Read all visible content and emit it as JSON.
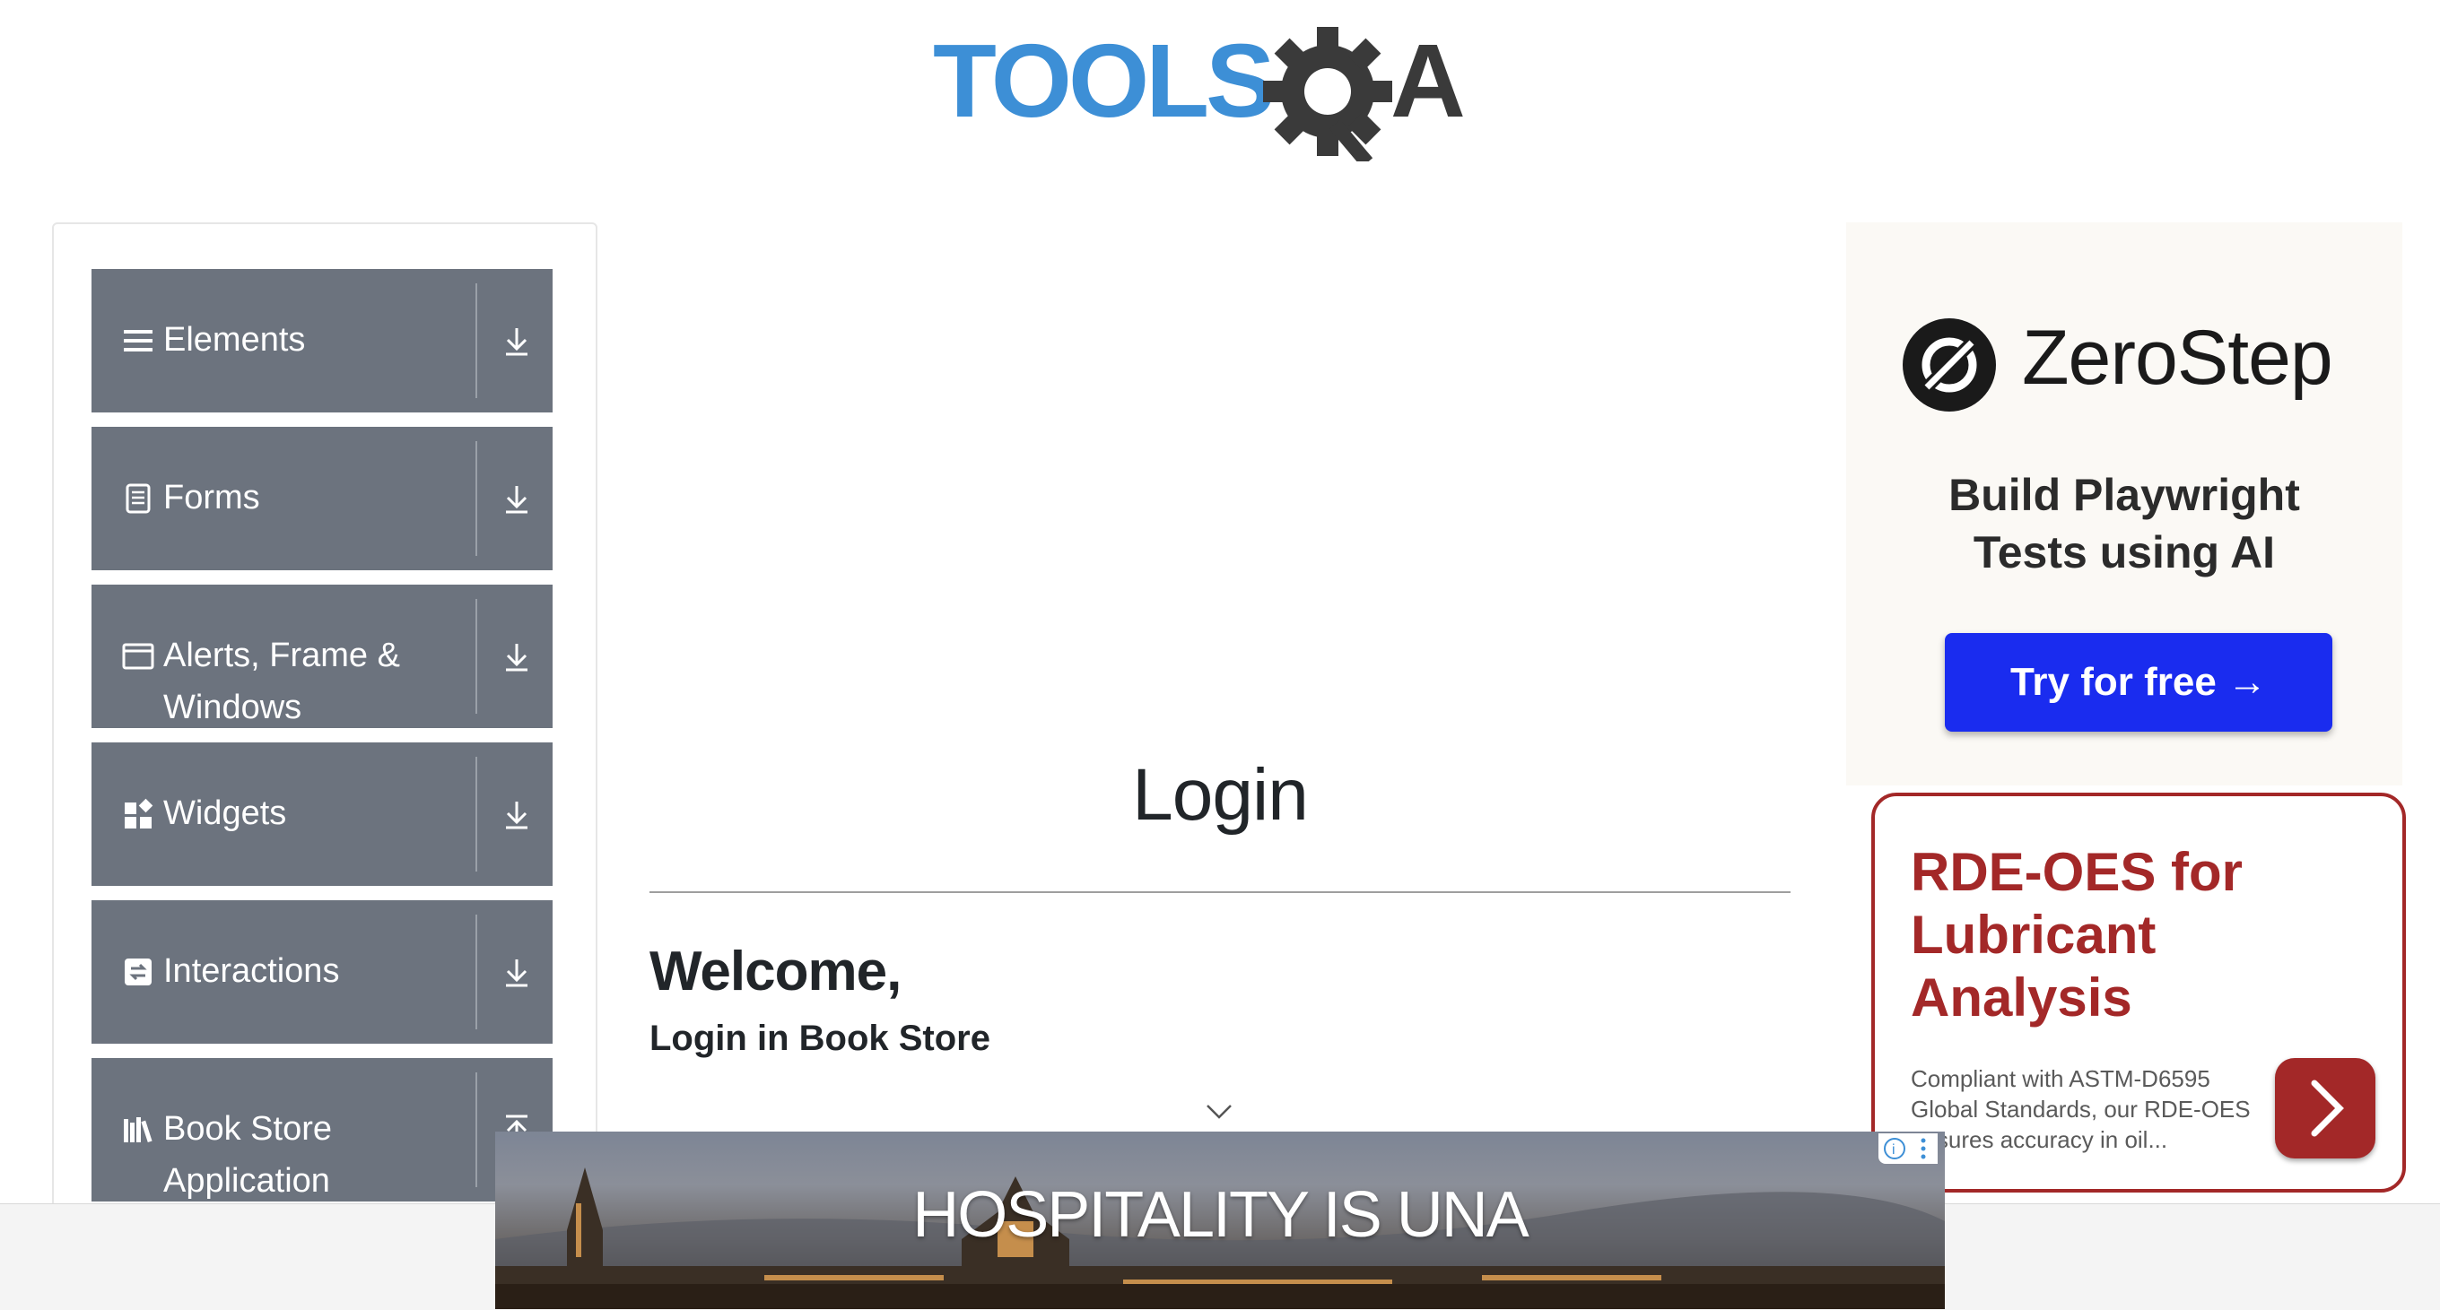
{
  "header": {
    "logo_text": "TOOLSQA"
  },
  "sidebar": {
    "groups": [
      {
        "label": "Elements",
        "icon": "list-icon"
      },
      {
        "label": "Forms",
        "icon": "document-icon"
      },
      {
        "label": "Alerts, Frame & Windows",
        "icon": "window-icon"
      },
      {
        "label": "Widgets",
        "icon": "widgets-icon"
      },
      {
        "label": "Interactions",
        "icon": "interaction-icon"
      },
      {
        "label": "Book Store Application",
        "icon": "books-icon"
      }
    ]
  },
  "main": {
    "title": "Login",
    "welcome": "Welcome,",
    "subtitle": "Login in Book Store"
  },
  "ads": {
    "zerostep": {
      "brand": "ZeroStep",
      "tagline_line1": "Build Playwright",
      "tagline_line2": "Tests using AI",
      "button": "Try for free →"
    },
    "rde": {
      "title": "RDE-OES for Lubricant Analysis",
      "body": "Compliant with ASTM-D6595 Global Standards, our RDE-OES ensures accuracy in oil..."
    },
    "banner": {
      "text": "HOSPITALITY IS UNA"
    }
  },
  "colors": {
    "sidebar_bg": "#6c737e",
    "logo_blue": "#3d8fd6",
    "logo_dark": "#3a3a3a",
    "cta_blue": "#1a2cef",
    "rde_red": "#a32828"
  }
}
